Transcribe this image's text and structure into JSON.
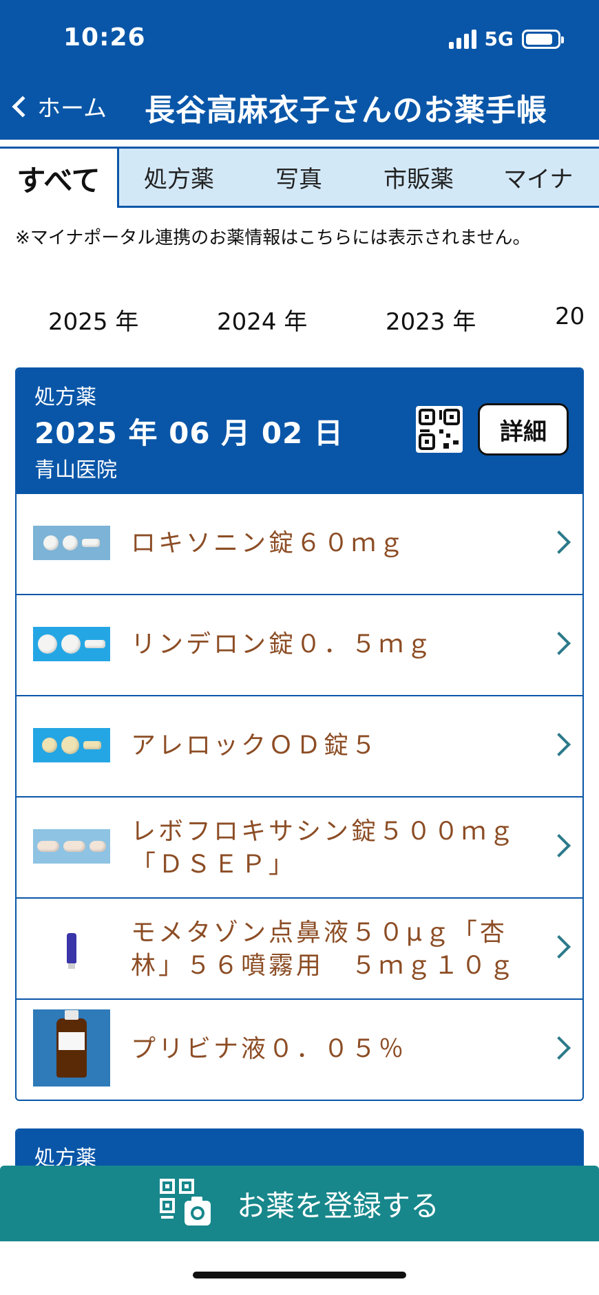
{
  "status": {
    "time": "10:26",
    "network": "5G"
  },
  "nav": {
    "back_label": "ホーム",
    "title": "長谷高麻衣子さんのお薬手帳"
  },
  "tabs": [
    {
      "label": "すべて",
      "active": true
    },
    {
      "label": "処方薬"
    },
    {
      "label": "写真"
    },
    {
      "label": "市販薬"
    },
    {
      "label": "マイナ"
    }
  ],
  "notice": "※マイナポータル連携のお薬情報はこちらには表示されません。",
  "years": [
    "2025 年",
    "2024 年",
    "2023 年",
    "20"
  ],
  "cards": [
    {
      "type": "処方薬",
      "date": "2025 年 06 月 02 日",
      "clinic": "青山医院",
      "detail_label": "詳細",
      "medicines": [
        {
          "name": "ロキソニン錠６０ｍｇ"
        },
        {
          "name": "リンデロン錠０．５ｍｇ"
        },
        {
          "name": "アレロックＯＤ錠５"
        },
        {
          "name": "レボフロキサシン錠５００ｍｇ「ＤＳＥＰ」"
        },
        {
          "name": "モメタゾン点鼻液５０μｇ「杏林」５６噴霧用　５ｍｇ１０ｇ"
        },
        {
          "name": "プリビナ液０．０５％"
        }
      ]
    },
    {
      "type": "処方薬"
    }
  ],
  "register_label": "お薬を登録する",
  "icons": [
    "chevron-left-icon",
    "signal-icon",
    "battery-icon",
    "qr-code-icon",
    "chevron-right-icon",
    "camera-icon"
  ],
  "colors": {
    "primary": "#0956a8",
    "tab_bg": "#d3e8f7",
    "medicine_text": "#8c4d25",
    "register_bg": "#17878b"
  }
}
